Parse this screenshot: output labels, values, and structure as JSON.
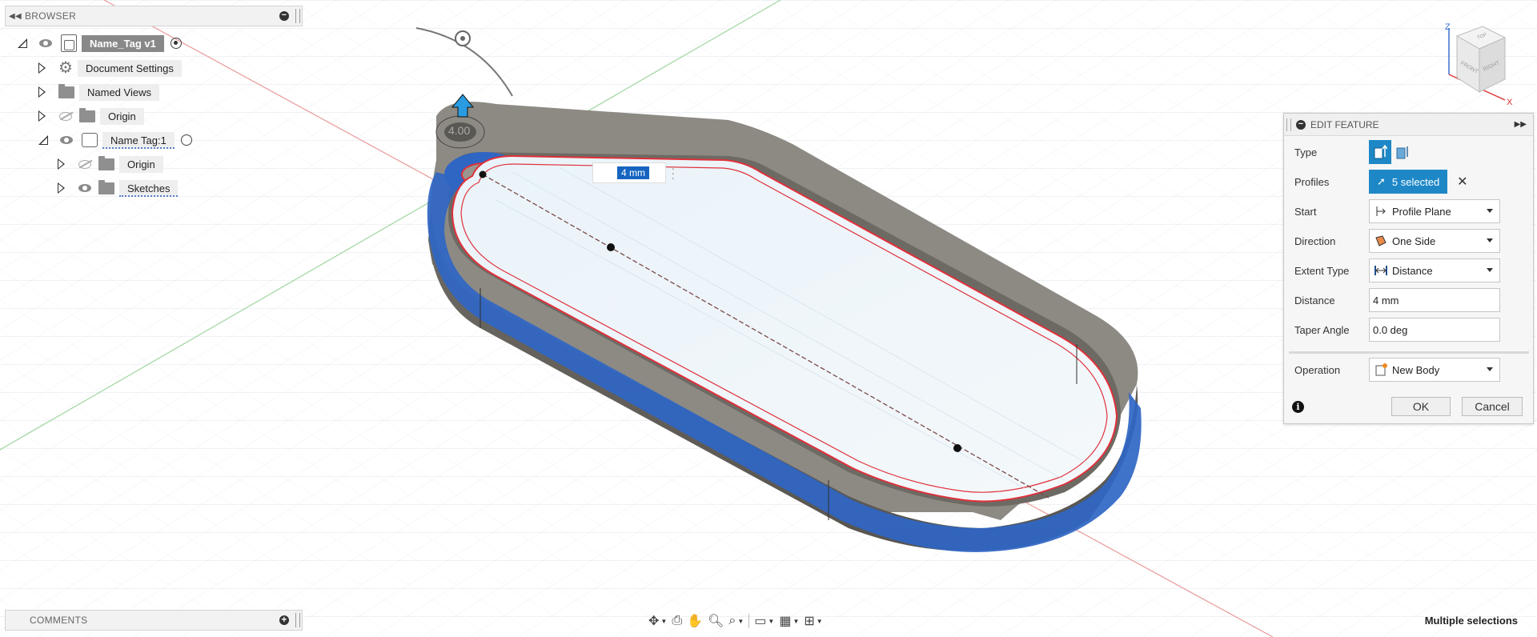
{
  "browser": {
    "title": "BROWSER",
    "root": {
      "label": "Name_Tag v1"
    },
    "items": [
      {
        "label": "Document Settings"
      },
      {
        "label": "Named Views"
      },
      {
        "label": "Origin"
      },
      {
        "label": "Name Tag:1"
      },
      {
        "label": "Origin"
      },
      {
        "label": "Sketches"
      }
    ]
  },
  "comments": {
    "title": "COMMENTS"
  },
  "canvas": {
    "distance_value": "4 mm",
    "dimension_label": "4.00"
  },
  "edit_feature": {
    "title": "EDIT FEATURE",
    "rows": {
      "type": {
        "label": "Type"
      },
      "profiles": {
        "label": "Profiles",
        "value": "5 selected"
      },
      "start": {
        "label": "Start",
        "value": "Profile Plane"
      },
      "direction": {
        "label": "Direction",
        "value": "One Side"
      },
      "extent_type": {
        "label": "Extent Type",
        "value": "Distance"
      },
      "distance": {
        "label": "Distance",
        "value": "4 mm"
      },
      "taper_angle": {
        "label": "Taper Angle",
        "value": "0.0 deg"
      },
      "operation": {
        "label": "Operation",
        "value": "New Body"
      }
    },
    "ok_label": "OK",
    "cancel_label": "Cancel",
    "info_glyph": "i"
  },
  "view_cube": {
    "faces": [
      "TOP",
      "FRONT",
      "RIGHT"
    ],
    "axes": [
      "Z",
      "X"
    ]
  },
  "status": {
    "text": "Multiple selections"
  },
  "colors": {
    "selection_blue": "#1e88c7",
    "face_highlight_blue": "#2f66c4",
    "body_gray": "#66645f",
    "profile_red": "#e0303a",
    "grid": "#d7dde4"
  },
  "toolbar_icons": [
    "orbit-icon",
    "look-at-icon",
    "pan-icon",
    "zoom-icon",
    "fit-icon",
    "display-settings-icon",
    "grid-icon",
    "viewports-icon"
  ]
}
